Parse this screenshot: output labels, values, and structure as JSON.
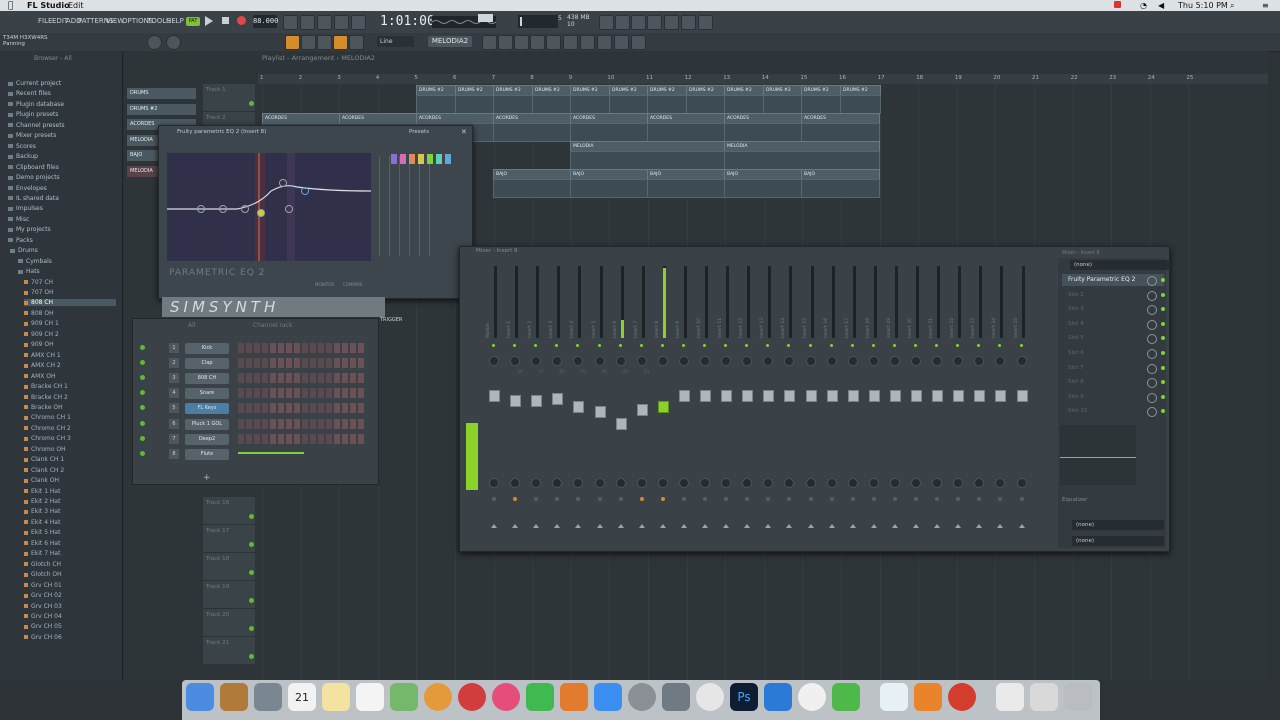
{
  "mac_menubar": {
    "app_name": "FL Studio",
    "edit": "Edit",
    "clock": "Thu 5:10 PM"
  },
  "fl_menu": [
    "FILE",
    "EDIT",
    "ADD",
    "PATTERNS",
    "VIEW",
    "OPTIONS",
    "TOOLS",
    "HELP"
  ],
  "transport": {
    "mode": "PAT",
    "tempo": "88.000",
    "time": "1:01:00",
    "cpu_top": "438 MB",
    "cpu_bottom": "10",
    "cpu_num": "5"
  },
  "hint_bar": {
    "line1": "T34M H3XW4RS",
    "line2": "Panning"
  },
  "toolbar2": {
    "snap": "Line",
    "pattern": "MELODIA2"
  },
  "browser": {
    "header": "Browser - All",
    "items": [
      {
        "label": "Current project",
        "type": "folder"
      },
      {
        "label": "Recent files",
        "type": "folder"
      },
      {
        "label": "Plugin database",
        "type": "folder"
      },
      {
        "label": "Plugin presets",
        "type": "folder"
      },
      {
        "label": "Channel presets",
        "type": "folder"
      },
      {
        "label": "Mixer presets",
        "type": "folder"
      },
      {
        "label": "Scores",
        "type": "folder"
      },
      {
        "label": "Backup",
        "type": "folder"
      },
      {
        "label": "Clipboard files",
        "type": "folder"
      },
      {
        "label": "Demo projects",
        "type": "folder"
      },
      {
        "label": "Envelopes",
        "type": "folder"
      },
      {
        "label": "IL shared data",
        "type": "folder"
      },
      {
        "label": "Impulses",
        "type": "folder"
      },
      {
        "label": "Misc",
        "type": "folder"
      },
      {
        "label": "My projects",
        "type": "folder"
      },
      {
        "label": "Packs",
        "type": "folder"
      },
      {
        "label": "Drums",
        "type": "folder"
      },
      {
        "label": "Cymbals",
        "type": "folder"
      },
      {
        "label": "Hats",
        "type": "folder"
      },
      {
        "label": "707 CH",
        "type": "file"
      },
      {
        "label": "707 OH",
        "type": "file"
      },
      {
        "label": "808 CH",
        "type": "file",
        "selected": true
      },
      {
        "label": "808 OH",
        "type": "file"
      },
      {
        "label": "909 CH 1",
        "type": "file"
      },
      {
        "label": "909 CH 2",
        "type": "file"
      },
      {
        "label": "909 OH",
        "type": "file"
      },
      {
        "label": "AMX CH 1",
        "type": "file"
      },
      {
        "label": "AMX CH 2",
        "type": "file"
      },
      {
        "label": "AMX OH",
        "type": "file"
      },
      {
        "label": "Bracke CH 1",
        "type": "file"
      },
      {
        "label": "Bracke CH 2",
        "type": "file"
      },
      {
        "label": "Bracke OH",
        "type": "file"
      },
      {
        "label": "Chromo CH 1",
        "type": "file"
      },
      {
        "label": "Chromo CH 2",
        "type": "file"
      },
      {
        "label": "Chromo CH 3",
        "type": "file"
      },
      {
        "label": "Chromo OH",
        "type": "file"
      },
      {
        "label": "Clank CH 1",
        "type": "file"
      },
      {
        "label": "Clank CH 2",
        "type": "file"
      },
      {
        "label": "Clank OH",
        "type": "file"
      },
      {
        "label": "Ekit 1 Hat",
        "type": "file"
      },
      {
        "label": "Ekit 2 Hat",
        "type": "file"
      },
      {
        "label": "Ekit 3 Hat",
        "type": "file"
      },
      {
        "label": "Ekit 4 Hat",
        "type": "file"
      },
      {
        "label": "Ekit 5 Hat",
        "type": "file"
      },
      {
        "label": "Ekit 6 Hat",
        "type": "file"
      },
      {
        "label": "Ekit 7 Hat",
        "type": "file"
      },
      {
        "label": "Glotch CH",
        "type": "file"
      },
      {
        "label": "Glotch OH",
        "type": "file"
      },
      {
        "label": "Grv CH 01",
        "type": "file"
      },
      {
        "label": "Grv CH 02",
        "type": "file"
      },
      {
        "label": "Grv CH 03",
        "type": "file"
      },
      {
        "label": "Grv CH 04",
        "type": "file"
      },
      {
        "label": "Grv CH 05",
        "type": "file"
      },
      {
        "label": "Grv CH 06",
        "type": "file"
      }
    ]
  },
  "playlist": {
    "title": "Playlist - Arrangement › MELODIA2",
    "ruler": [
      "1",
      "2",
      "3",
      "4",
      "5",
      "6",
      "7",
      "8",
      "9",
      "10",
      "11",
      "12",
      "13",
      "14",
      "15",
      "16",
      "17",
      "18",
      "19",
      "20",
      "21",
      "22",
      "23",
      "24",
      "25"
    ],
    "picker": [
      "DRUMS",
      "DRUMS #2",
      "ACORDES",
      "MELODIA",
      "BAJO",
      "MELODIA"
    ],
    "tracks": [
      "Track 1",
      "Track 2",
      "Track 16",
      "Track 17",
      "Track 18",
      "Track 19",
      "Track 20",
      "Track 21"
    ],
    "clips": {
      "drums": "DRUMS #2",
      "acordes": "ACORDES",
      "melodia": "MELODIA",
      "bajo": "BAJO"
    }
  },
  "eq_window": {
    "title": "Fruity parametric EQ 2 (Insert 8)",
    "presets": "Presets",
    "logo": "PARAMETRIC EQ 2",
    "monitor": "MONITOR",
    "compare": "COMPARE"
  },
  "synth": {
    "logo": "SIMSYNTH",
    "trigger": "TRIGGER"
  },
  "channel_rack": {
    "title": "Channel rack",
    "filter": "All",
    "channels": [
      {
        "num": "1",
        "name": "Kick"
      },
      {
        "num": "2",
        "name": "Clap"
      },
      {
        "num": "3",
        "name": "808 CH"
      },
      {
        "num": "4",
        "name": "Snare"
      },
      {
        "num": "5",
        "name": "FL Keys",
        "selected": true
      },
      {
        "num": "6",
        "name": "Pluck 1 GOL"
      },
      {
        "num": "7",
        "name": "Deep2"
      },
      {
        "num": "8",
        "name": "Flute"
      }
    ],
    "add": "+"
  },
  "mixer": {
    "title": "Mixer - Insert 8",
    "inserts": [
      "Master",
      "Insert 1",
      "Insert 2",
      "Insert 3",
      "Insert 4",
      "Insert 5",
      "Insert 6",
      "Insert 7",
      "Insert 8",
      "Insert 9",
      "Insert 10",
      "Insert 11",
      "Insert 12",
      "Insert 13",
      "Insert 14",
      "Insert 15",
      "Insert 16",
      "Insert 17",
      "Insert 18",
      "Insert 19",
      "Insert 20",
      "Insert 21",
      "Insert 22",
      "Insert 23",
      "Insert 24",
      "Insert 25"
    ],
    "track_labels": [
      "34",
      "37",
      "83",
      "45",
      "46",
      "42",
      "43"
    ],
    "fx_header": "Mixer - Insert 8",
    "fx_top": "(none)",
    "slots": [
      "Fruity Parametric EQ 2",
      "Slot 2",
      "Slot 3",
      "Slot 4",
      "Slot 5",
      "Slot 6",
      "Slot 7",
      "Slot 8",
      "Slot 9",
      "Slot 10"
    ],
    "equalizer_label": "Equalizer",
    "out1": "(none)",
    "out2": "(none)"
  },
  "dock": {
    "calendar_day": "21",
    "calendar_month": "MAY",
    "ps_label": "Ps"
  },
  "colors": {
    "accent_orange": "#d58c2a",
    "led_green": "#7fd33a",
    "meter_green": "#8bd12a"
  }
}
